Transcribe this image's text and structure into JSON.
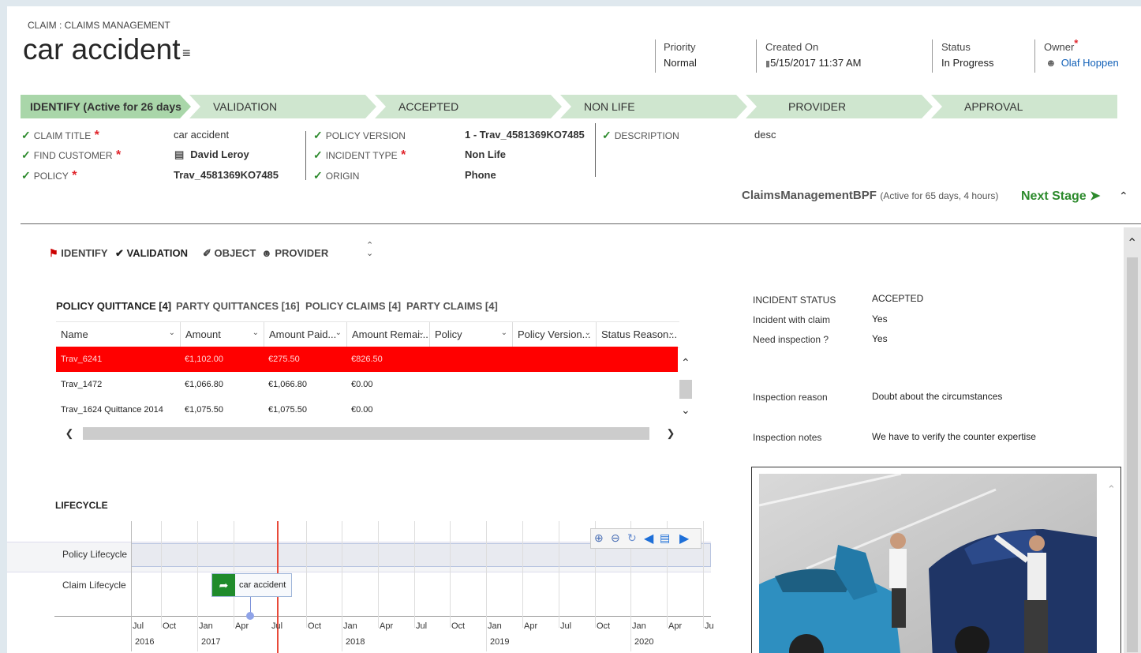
{
  "header": {
    "entity_label": "CLAIM : CLAIMS MANAGEMENT",
    "title": "car accident",
    "fields": [
      {
        "label": "Priority",
        "value": "Normal"
      },
      {
        "label": "Created On",
        "value": "5/15/2017  11:37 AM"
      },
      {
        "label": "Status",
        "value": "In Progress"
      },
      {
        "label": "Owner",
        "value": "Olaf Hoppen"
      }
    ]
  },
  "bpf": {
    "stages": [
      "IDENTIFY (Active for 26 days",
      "VALIDATION",
      "ACCEPTED",
      "NON LIFE",
      "PROVIDER",
      "APPROVAL"
    ],
    "fields_col1": [
      {
        "label": "CLAIM TITLE",
        "value": "car accident",
        "required": true
      },
      {
        "label": "FIND CUSTOMER",
        "value": "David Leroy",
        "required": true
      },
      {
        "label": "POLICY",
        "value": "Trav_4581369KO7485",
        "required": true
      }
    ],
    "fields_col2": [
      {
        "label": "POLICY VERSION",
        "value": "1 - Trav_4581369KO7485"
      },
      {
        "label": "INCIDENT TYPE",
        "value": "Non Life",
        "required": true
      },
      {
        "label": "ORIGIN",
        "value": "Phone"
      }
    ],
    "fields_col3": [
      {
        "label": "DESCRIPTION",
        "value": "desc"
      }
    ],
    "process_name": "ClaimsManagementBPF",
    "process_active": "(Active for 65 days, 4 hours)",
    "next_stage": "Next Stage"
  },
  "nav": {
    "items": [
      "IDENTIFY",
      "VALIDATION",
      "OBJECT",
      "PROVIDER"
    ]
  },
  "subgrid": {
    "tabs": [
      "POLICY QUITTANCE [4]",
      "PARTY QUITTANCES [16]",
      "POLICY CLAIMS [4]",
      "PARTY CLAIMS [4]"
    ],
    "columns": [
      "Name",
      "Amount",
      "Amount Paid...",
      "Amount Remai...",
      "Policy",
      "Policy Version...",
      "Status Reason..."
    ],
    "rows": [
      [
        "Trav_6241",
        "€1,102.00",
        "€275.50",
        "€826.50"
      ],
      [
        "Trav_1472",
        "€1,066.80",
        "€1,066.80",
        "€0.00"
      ],
      [
        "Trav_1624 Quittance 2014",
        "€1,075.50",
        "€1,075.50",
        "€0.00"
      ]
    ]
  },
  "lifecycle": {
    "title": "LIFECYCLE",
    "rows": [
      "Policy Lifecycle",
      "Claim Lifecycle"
    ],
    "event": "car accident",
    "months": [
      "Jul",
      "Oct",
      "Jan",
      "Apr",
      "Jul",
      "Oct",
      "Jan",
      "Apr",
      "Jul",
      "Oct",
      "Jan",
      "Apr",
      "Jul",
      "Oct",
      "Jan",
      "Apr",
      "Ju"
    ],
    "years": [
      "2016",
      "2017",
      "2018",
      "2019",
      "2020"
    ]
  },
  "details": {
    "fields": [
      {
        "label": "INCIDENT STATUS",
        "value": "ACCEPTED"
      },
      {
        "label": "Incident with claim",
        "value": "Yes"
      },
      {
        "label": "Need inspection ?",
        "value": "Yes"
      },
      {
        "label": "Inspection reason",
        "value": "Doubt about the circumstances"
      },
      {
        "label": "Inspection notes",
        "value": "We have to verify the counter expertise"
      }
    ]
  },
  "colors": {
    "stage_active": "#a9d6a9",
    "stage": "#cfe6cf",
    "link": "#1160b7",
    "highlight_row": "#ff0000",
    "next_stage": "#2c8a2c"
  }
}
